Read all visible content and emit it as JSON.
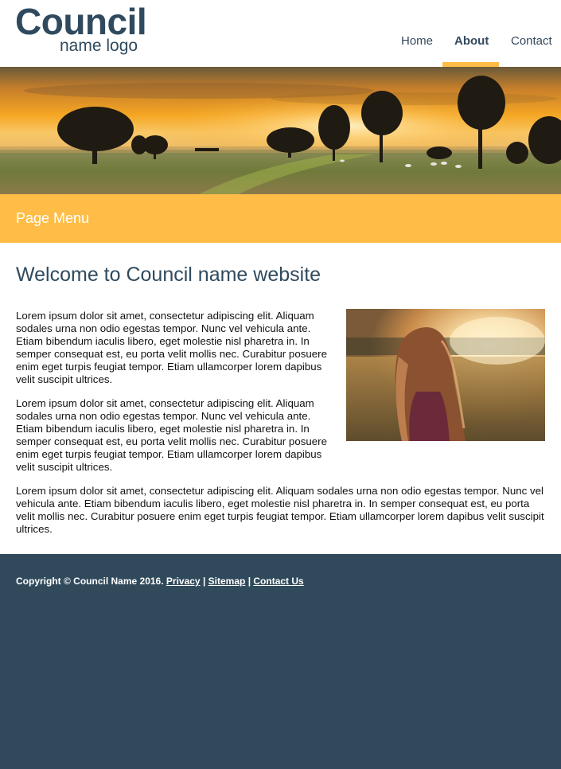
{
  "logo": {
    "main": "Council",
    "sub": "name logo"
  },
  "nav": {
    "items": [
      {
        "label": "Home"
      },
      {
        "label": "About",
        "active": true
      },
      {
        "label": "Contact"
      }
    ]
  },
  "colors": {
    "accent": "#ffbd47",
    "dark": "#304a5c",
    "heading": "#2f4a5e"
  },
  "page_menu": {
    "label": "Page Menu"
  },
  "main": {
    "title": "Welcome to Council name website",
    "paragraphs": [
      "Lorem ipsum dolor sit amet, consectetur adipiscing elit. Aliquam sodales urna non odio egestas tempor. Nunc vel vehicula ante. Etiam bibendum iaculis libero, eget molestie nisl pharetra in. In semper consequat est, eu porta velit mollis nec. Curabitur posuere enim eget turpis feugiat tempor. Etiam ullamcorper lorem dapibus velit suscipit ultrices.",
      "Lorem ipsum dolor sit amet, consectetur adipiscing elit. Aliquam sodales urna non odio egestas tempor. Nunc vel vehicula ante. Etiam bibendum iaculis libero, eget molestie nisl pharetra in. In semper consequat est, eu porta velit mollis nec. Curabitur posuere enim eget turpis feugiat tempor. Etiam ullamcorper lorem dapibus velit suscipit ultrices.",
      "Lorem ipsum dolor sit amet, consectetur adipiscing elit. Aliquam sodales urna non odio egestas tempor. Nunc vel vehicula ante. Etiam bibendum iaculis libero, eget molestie nisl pharetra in. In semper consequat est, eu porta velit mollis nec. Curabitur posuere enim eget turpis feugiat tempor. Etiam ullamcorper lorem dapibus velit suscipit ultrices."
    ]
  },
  "footer": {
    "copyright": "Copyright © Council Name 2016.",
    "sep": "|",
    "links": [
      {
        "label": "Privacy"
      },
      {
        "label": "Sitemap"
      },
      {
        "label": "Contact Us"
      }
    ]
  }
}
